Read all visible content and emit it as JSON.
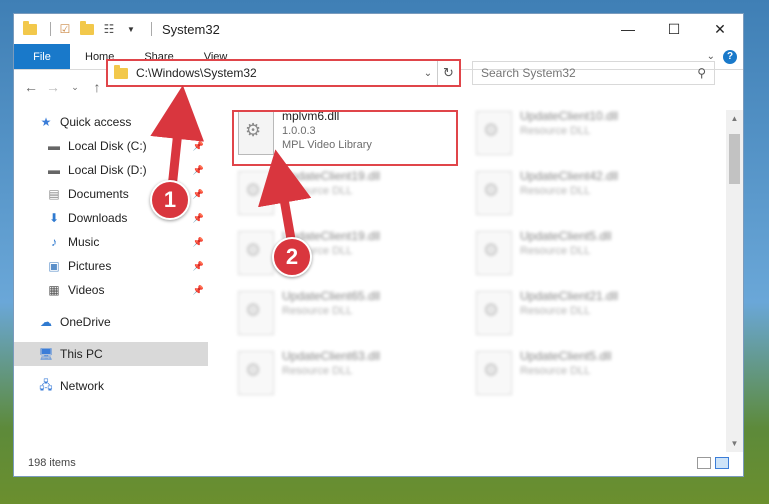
{
  "window": {
    "title": "System32",
    "controls": {
      "minimize": "—",
      "maximize": "☐",
      "close": "✕"
    }
  },
  "ribbon": {
    "tabs": [
      "File",
      "Home",
      "Share",
      "View"
    ],
    "help": "?"
  },
  "address": {
    "path": "C:\\Windows\\System32",
    "search_placeholder": "Search System32"
  },
  "sidebar": {
    "quick_access": "Quick access",
    "items": [
      {
        "label": "Local Disk (C:)",
        "icon": "drive-icon",
        "pinned": true
      },
      {
        "label": "Local Disk (D:)",
        "icon": "drive-icon",
        "pinned": true
      },
      {
        "label": "Documents",
        "icon": "documents-icon",
        "pinned": true
      },
      {
        "label": "Downloads",
        "icon": "download-icon",
        "pinned": true
      },
      {
        "label": "Music",
        "icon": "music-icon",
        "pinned": true
      },
      {
        "label": "Pictures",
        "icon": "pictures-icon",
        "pinned": true
      },
      {
        "label": "Videos",
        "icon": "videos-icon",
        "pinned": true
      }
    ],
    "onedrive": "OneDrive",
    "this_pc": "This PC",
    "network": "Network"
  },
  "files": {
    "highlighted": {
      "name": "mplvm6.dll",
      "version": "1.0.0.3",
      "description": "MPL Video Library"
    },
    "others": [
      {
        "name": "UpdateClient10.dll",
        "type": "Resource DLL"
      },
      {
        "name": "UpdateClient19.dll",
        "type": "Resource DLL"
      },
      {
        "name": "UpdateClient42.dll",
        "type": "Resource DLL"
      },
      {
        "name": "UpdateClient19.dll",
        "type": "Resource DLL"
      },
      {
        "name": "UpdateClient5.dll",
        "type": "Resource DLL"
      },
      {
        "name": "UpdateClient65.dll",
        "type": "Resource DLL"
      },
      {
        "name": "UpdateClient21.dll",
        "type": "Resource DLL"
      },
      {
        "name": "UpdateClient63.dll",
        "type": "Resource DLL"
      },
      {
        "name": "UpdateClient5.dll",
        "type": "Resource DLL"
      }
    ]
  },
  "status": {
    "item_count": "198 items"
  },
  "annotations": {
    "marker1": "1",
    "marker2": "2",
    "color": "#d9363e"
  }
}
